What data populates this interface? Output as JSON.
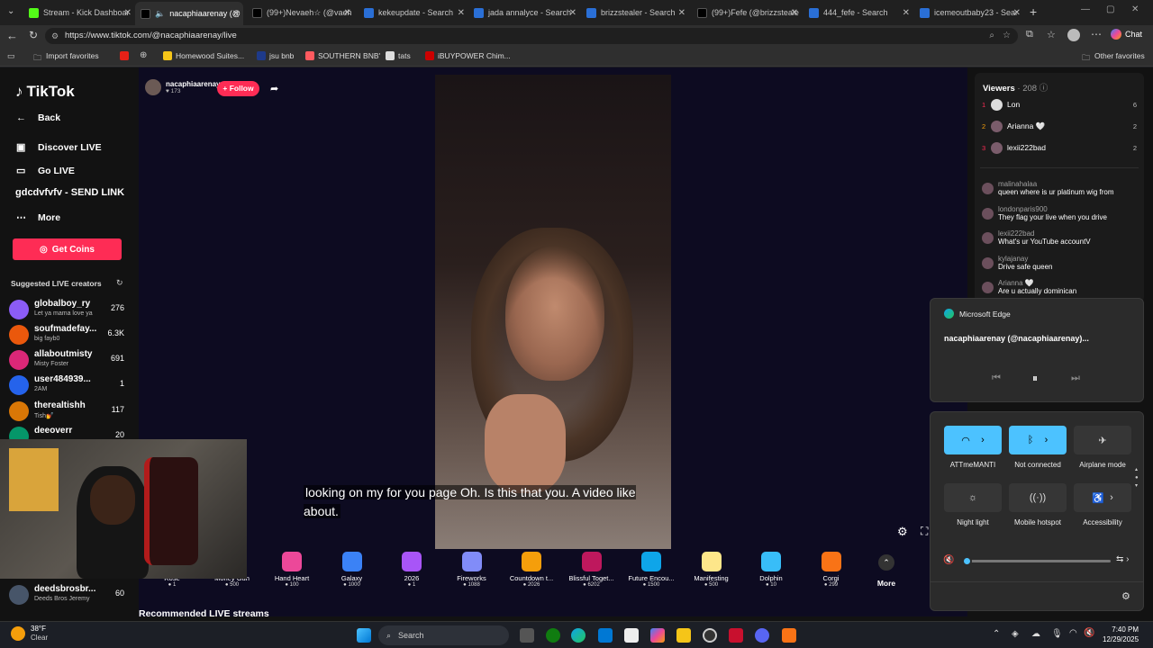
{
  "tabs": [
    {
      "label": "Stream - Kick Dashboar",
      "active": false
    },
    {
      "label": "nacaphiaarenay (@",
      "active": true
    },
    {
      "label": "(99+)Nevaeh☆ (@vaeh",
      "active": false
    },
    {
      "label": "kekeupdate - Search",
      "active": false
    },
    {
      "label": "jada annalyce - Search",
      "active": false
    },
    {
      "label": "brizzstealer - Search",
      "active": false
    },
    {
      "label": "(99+)Fefe (@brizzsteale",
      "active": false
    },
    {
      "label": "444_fefe - Search",
      "active": false
    },
    {
      "label": "icemeoutbaby23 - Sear",
      "active": false
    }
  ],
  "address": {
    "url": "https://www.tiktok.com/@nacaphiaarenay/live",
    "chat_label": "Chat"
  },
  "bookmarks": {
    "items": [
      "Import favorites",
      "Homewood Suites...",
      "jsu bnb",
      "SOUTHERN BNB'",
      "tats",
      "iBUYPOWER Chim..."
    ],
    "other": "Other favorites"
  },
  "tiktok": {
    "logo": "TikTok",
    "nav": {
      "back": "Back",
      "discover": "Discover LIVE",
      "golive": "Go LIVE",
      "overlay": "gdcdvfvfv - SEND LINK",
      "more": "More"
    },
    "get_coins": "Get Coins",
    "suggested_title": "Suggested LIVE creators",
    "creators": [
      {
        "name": "globalboy_ry",
        "sub": "Let ya mama love ya",
        "count": "276"
      },
      {
        "name": "soufmadefay...",
        "sub": "big fayb0",
        "count": "6.3K"
      },
      {
        "name": "allaboutmisty",
        "sub": "Misty Foster",
        "count": "691"
      },
      {
        "name": "user484939...",
        "sub": "2AM",
        "count": "1"
      },
      {
        "name": "therealtishh",
        "sub": "Tish💅",
        "count": "117"
      },
      {
        "name": "deeoverr",
        "sub": "",
        "count": "20"
      },
      {
        "name": "deedsbrosbr...",
        "sub": "Deeds Bros Jeremy",
        "count": "60"
      }
    ],
    "streamer": {
      "name": "nacaphiaarenay",
      "likes": "173",
      "follow": "+ Follow"
    },
    "subtitle": "looking on my for you page Oh. Is this that you. A video like about.",
    "gifts": [
      {
        "name": "Rose",
        "price": "1"
      },
      {
        "name": "Money Gun",
        "price": "500"
      },
      {
        "name": "Hand Heart",
        "price": "100"
      },
      {
        "name": "Galaxy",
        "price": "1000"
      },
      {
        "name": "2026",
        "price": "1"
      },
      {
        "name": "Fireworks",
        "price": "1088"
      },
      {
        "name": "Countdown t...",
        "price": "2026"
      },
      {
        "name": "Blissful Toget...",
        "price": "6202"
      },
      {
        "name": "Future Encou...",
        "price": "1500"
      },
      {
        "name": "Manifesting",
        "price": "500"
      },
      {
        "name": "Dolphin",
        "price": "10"
      },
      {
        "name": "Corgi",
        "price": "299"
      }
    ],
    "gifts_more": "More",
    "recommended": "Recommended LIVE streams",
    "viewers_title": "Viewers",
    "viewers_count": "208",
    "viewers": [
      {
        "rank": "1",
        "name": "Lon",
        "score": "6"
      },
      {
        "rank": "2",
        "name": "Arianna 🤍",
        "score": "2"
      },
      {
        "rank": "3",
        "name": "lexii222bad",
        "score": "2"
      }
    ],
    "chat": [
      {
        "user": "malinahalaa",
        "msg": "queen where is ur platinum wig from"
      },
      {
        "user": "londonparis900",
        "msg": "They flag your live when you drive"
      },
      {
        "user": "lexii222bad",
        "msg": "What's ur YouTube accountV"
      },
      {
        "user": "kylajanay",
        "msg": "Drive safe queen"
      },
      {
        "user": "Arianna 🤍",
        "msg": "Are u actually dominican"
      }
    ]
  },
  "media_flyout": {
    "app": "Microsoft Edge",
    "title": "nacaphiaarenay (@nacaphiaarenay)..."
  },
  "quick_settings": {
    "wifi": "ATTmeMANTI",
    "bluetooth": "Not connected",
    "airplane": "Airplane mode",
    "nightlight": "Night light",
    "hotspot": "Mobile hotspot",
    "accessibility": "Accessibility",
    "volume_level": 0.0
  },
  "taskbar": {
    "weather_temp": "38°F",
    "weather_desc": "Clear",
    "search": "Search",
    "time": "7:40 PM",
    "date": "12/29/2025"
  },
  "colors": {
    "accent": "#fe2c55",
    "qs_active": "#4cc2ff"
  }
}
